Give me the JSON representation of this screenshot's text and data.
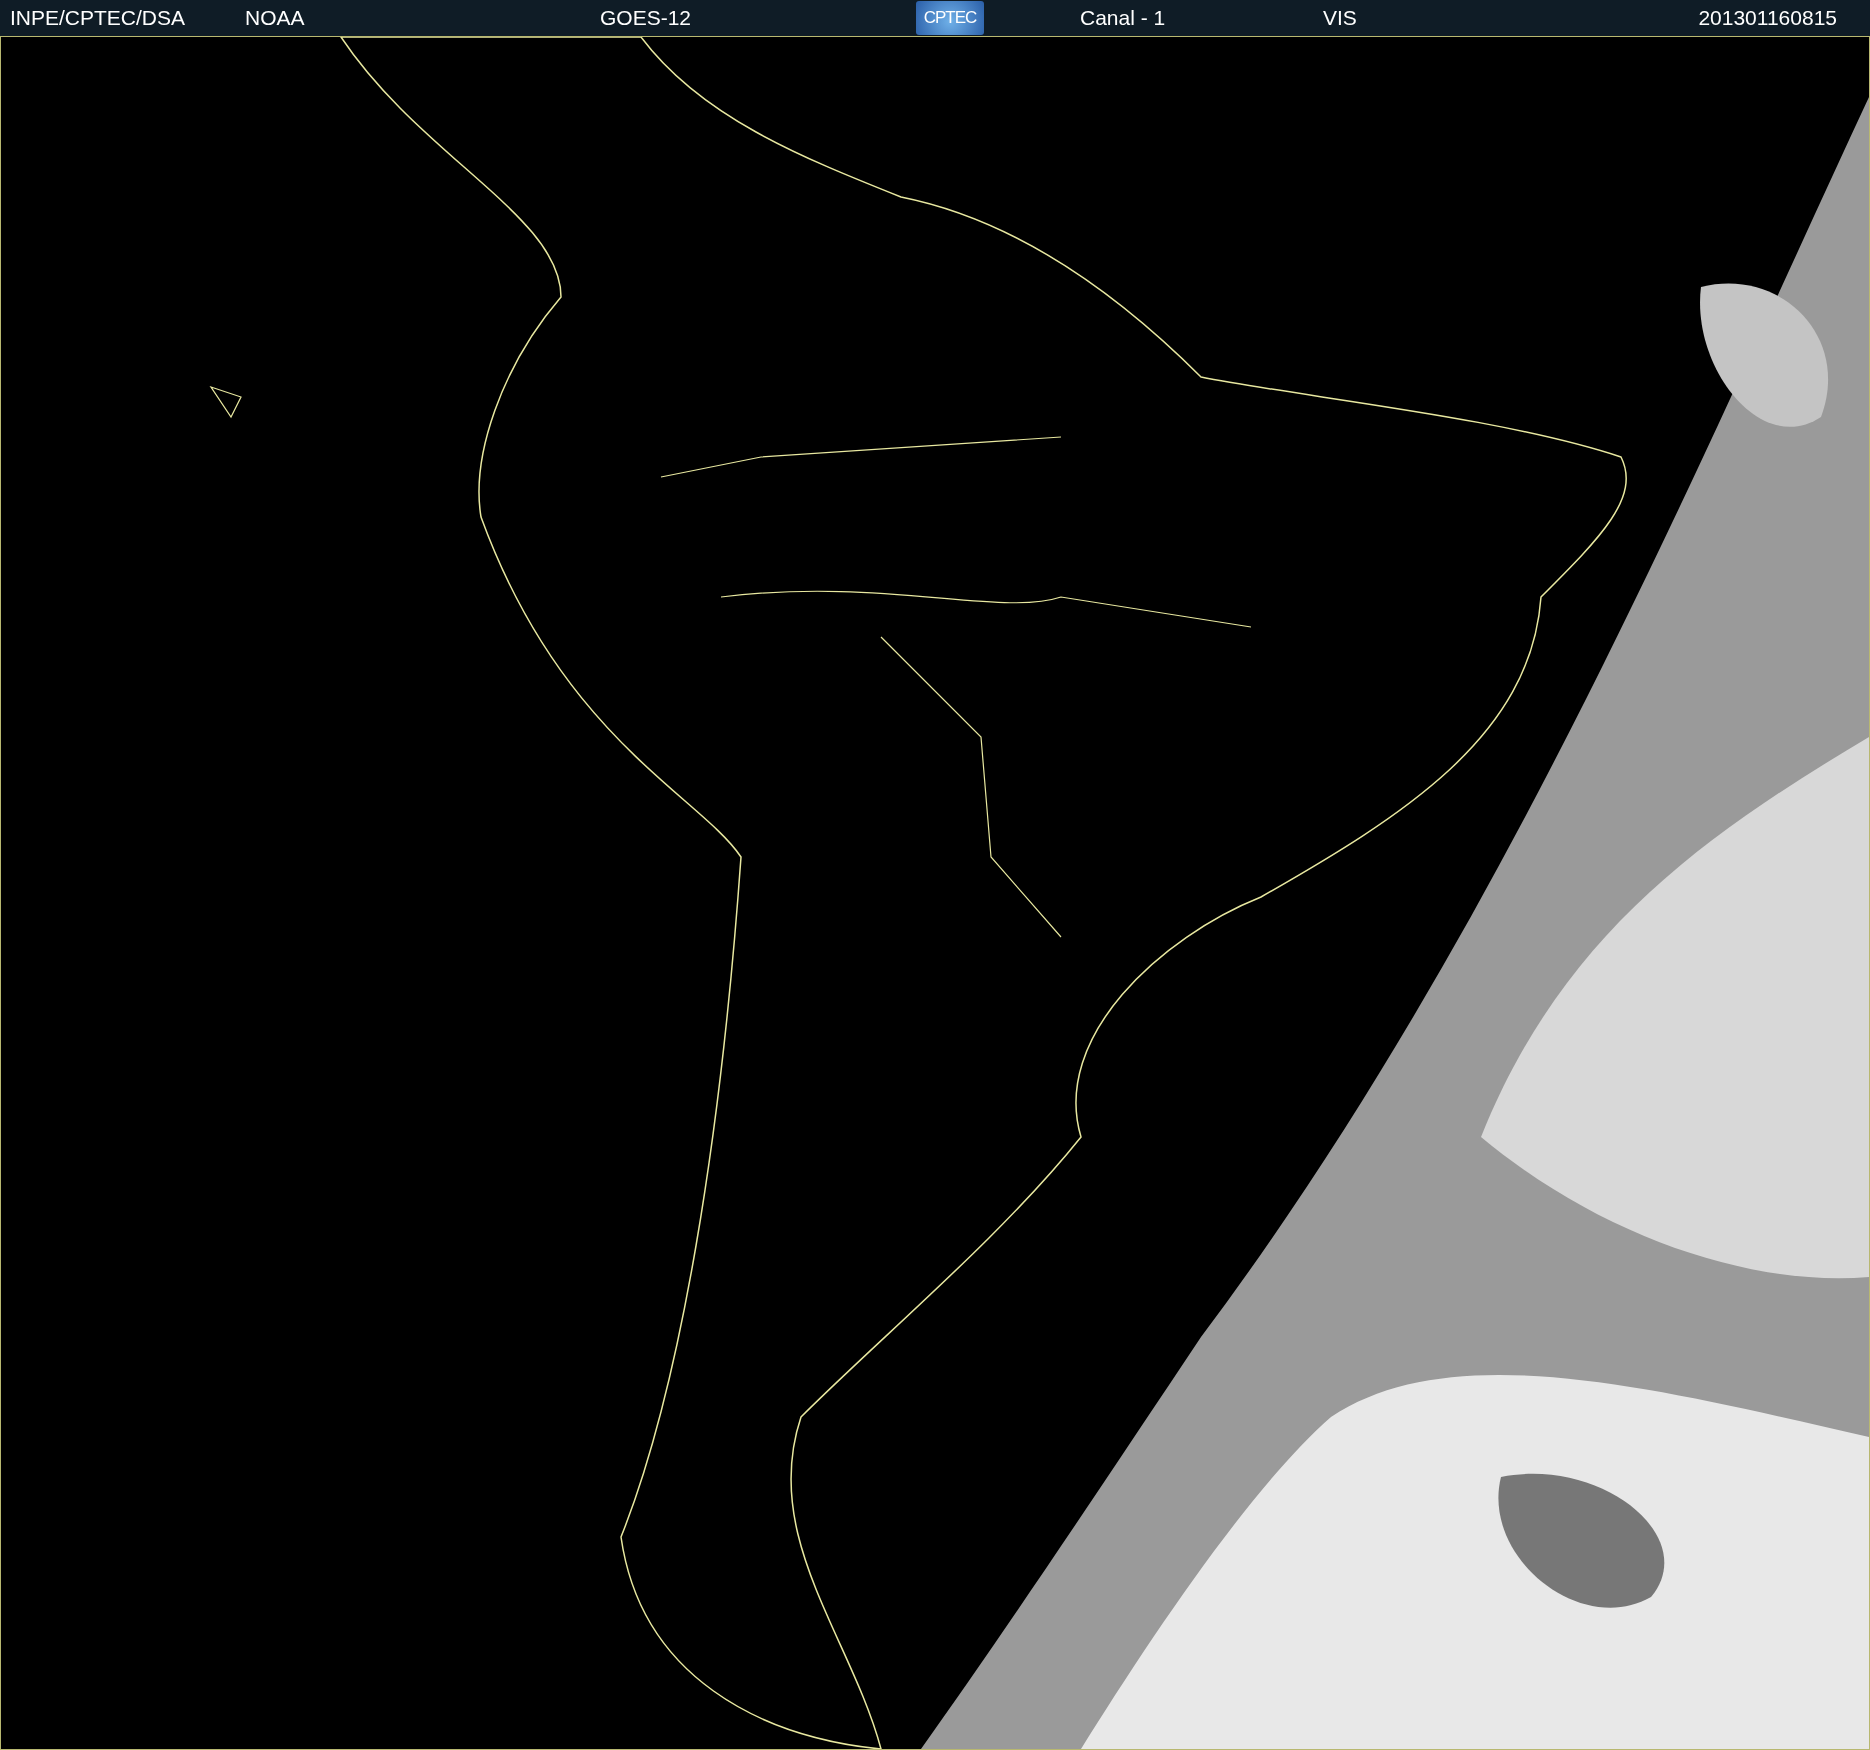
{
  "header": {
    "source": "INPE/CPTEC/DSA",
    "agency": "NOAA",
    "satellite": "GOES-12",
    "logo": "CPTEC",
    "channel": "Canal - 1",
    "band": "VIS",
    "timestamp": "201301160815"
  }
}
